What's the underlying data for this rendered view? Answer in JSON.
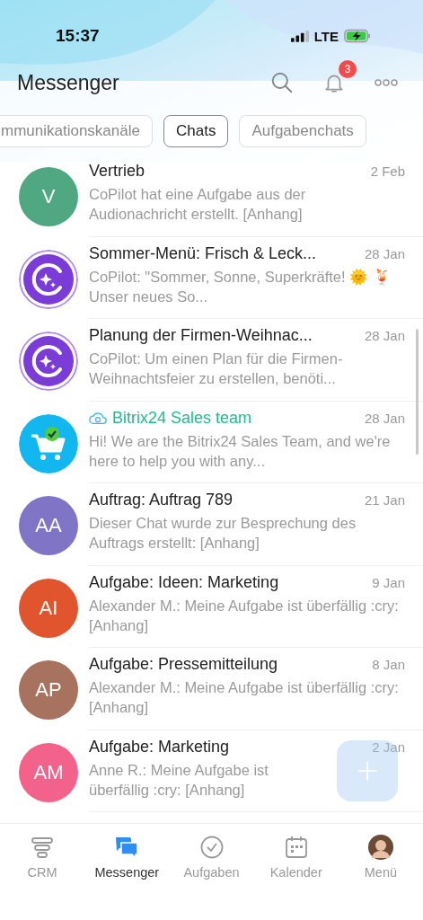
{
  "status_bar": {
    "time": "15:37",
    "network": "LTE"
  },
  "header": {
    "title": "Messenger",
    "notifications_badge": "3"
  },
  "filters": [
    {
      "label": "mmunikationskanäle",
      "selected": false
    },
    {
      "label": "Chats",
      "selected": true
    },
    {
      "label": "Aufgabenchats",
      "selected": false
    }
  ],
  "chats": [
    {
      "kind": "initials",
      "initials": "V",
      "color": "#4fa882",
      "title": "Vertrieb",
      "date": "2 Feb",
      "preview": "CoPilot hat eine Aufgabe aus der Audionachricht erstellt. [Anhang]"
    },
    {
      "kind": "copilot",
      "title": "Sommer-Menü: Frisch & Leck...",
      "date": "28 Jan",
      "preview": "CoPilot: \"Sommer, Sonne, Superkräfte! 🌞 🍹 Unser neues So..."
    },
    {
      "kind": "copilot",
      "title": "Planung der Firmen-Weihnac...",
      "date": "28 Jan",
      "preview": "CoPilot: Um einen Plan für die Firmen-Weihnachtsfeier zu erstellen, benöti..."
    },
    {
      "kind": "channel",
      "title": "Bitrix24 Sales team",
      "date": "28 Jan",
      "preview": "Hi! We are the Bitrix24 Sales Team, and we're here to help you with any..."
    },
    {
      "kind": "initials",
      "initials": "AA",
      "color": "#8074c6",
      "title": "Auftrag: Auftrag 789",
      "date": "21 Jan",
      "preview": "Dieser Chat wurde zur Besprechung des Auftrags erstellt: [Anhang]"
    },
    {
      "kind": "initials",
      "initials": "AI",
      "color": "#e0552d",
      "title": "Aufgabe: Ideen: Marketing",
      "date": "9 Jan",
      "preview": "Alexander M.: Meine Aufgabe ist überfällig :cry: [Anhang]"
    },
    {
      "kind": "initials",
      "initials": "AP",
      "color": "#a8735e",
      "title": "Aufgabe: Pressemitteilung",
      "date": "8 Jan",
      "preview": "Alexander M.: Meine Aufgabe ist überfällig :cry: [Anhang]"
    },
    {
      "kind": "initials",
      "initials": "AM",
      "color": "#f2628a",
      "title": "Aufgabe: Marketing",
      "date": "2 Jan",
      "preview": "Anne R.: Meine Aufgabe ist überfällig :cry: [Anhang]"
    }
  ],
  "tab_bar": [
    {
      "kind": "crm",
      "label": "CRM",
      "selected": false
    },
    {
      "kind": "messenger",
      "label": "Messenger",
      "selected": true
    },
    {
      "kind": "tasks",
      "label": "Aufgaben",
      "selected": false
    },
    {
      "kind": "calendar",
      "label": "Kalender",
      "selected": false
    },
    {
      "kind": "profile",
      "label": "Menü",
      "selected": false
    }
  ]
}
